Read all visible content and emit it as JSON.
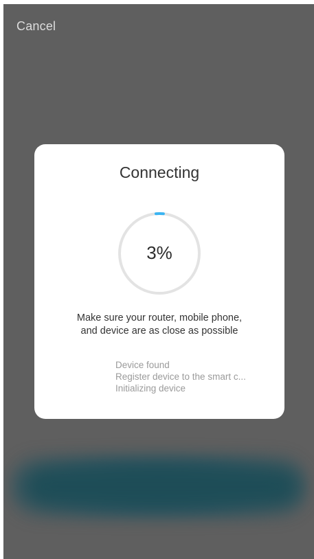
{
  "header": {
    "cancel_label": "Cancel"
  },
  "dialog": {
    "title": "Connecting",
    "progress": {
      "value_percent": 3,
      "label": "3%",
      "track_color": "#e3e3e3",
      "fill_color": "#3ab4f2"
    },
    "hint_line1": "Make sure your router, mobile phone,",
    "hint_line2": "and device are as close as possible",
    "steps": [
      {
        "label": "Device found"
      },
      {
        "label": "Register device to the smart c..."
      },
      {
        "label": "Initializing device"
      }
    ]
  },
  "colors": {
    "background_dim": "#5f5f5f",
    "dialog_background": "#ffffff",
    "blurred_button": "#1e4d57"
  }
}
